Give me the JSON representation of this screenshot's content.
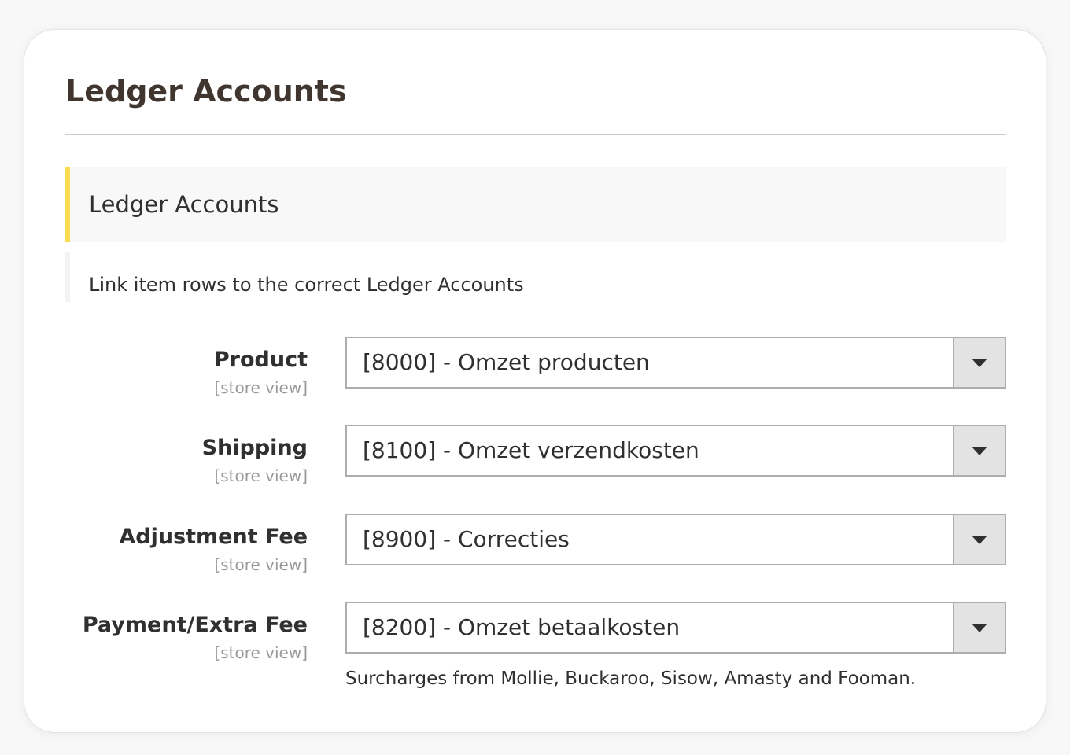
{
  "page": {
    "title": "Ledger Accounts"
  },
  "section": {
    "title": "Ledger Accounts",
    "comment": "Link item rows to the correct Ledger Accounts"
  },
  "fields": [
    {
      "label": "Product",
      "scope": "[store view]",
      "value": "[8000] - Omzet producten"
    },
    {
      "label": "Shipping",
      "scope": "[store view]",
      "value": "[8100] - Omzet verzendkosten"
    },
    {
      "label": "Adjustment Fee",
      "scope": "[store view]",
      "value": "[8900] - Correcties"
    },
    {
      "label": "Payment/Extra Fee",
      "scope": "[store view]",
      "value": "[8200] - Omzet betaalkosten",
      "note": "Surcharges from Mollie, Buckaroo, Sisow, Amasty and Fooman."
    }
  ],
  "colors": {
    "accent": "#f8db4e",
    "title": "#41362f",
    "text": "#303030",
    "muted": "#999999",
    "border": "#adadad",
    "toggle_bg": "#e3e3e3"
  }
}
